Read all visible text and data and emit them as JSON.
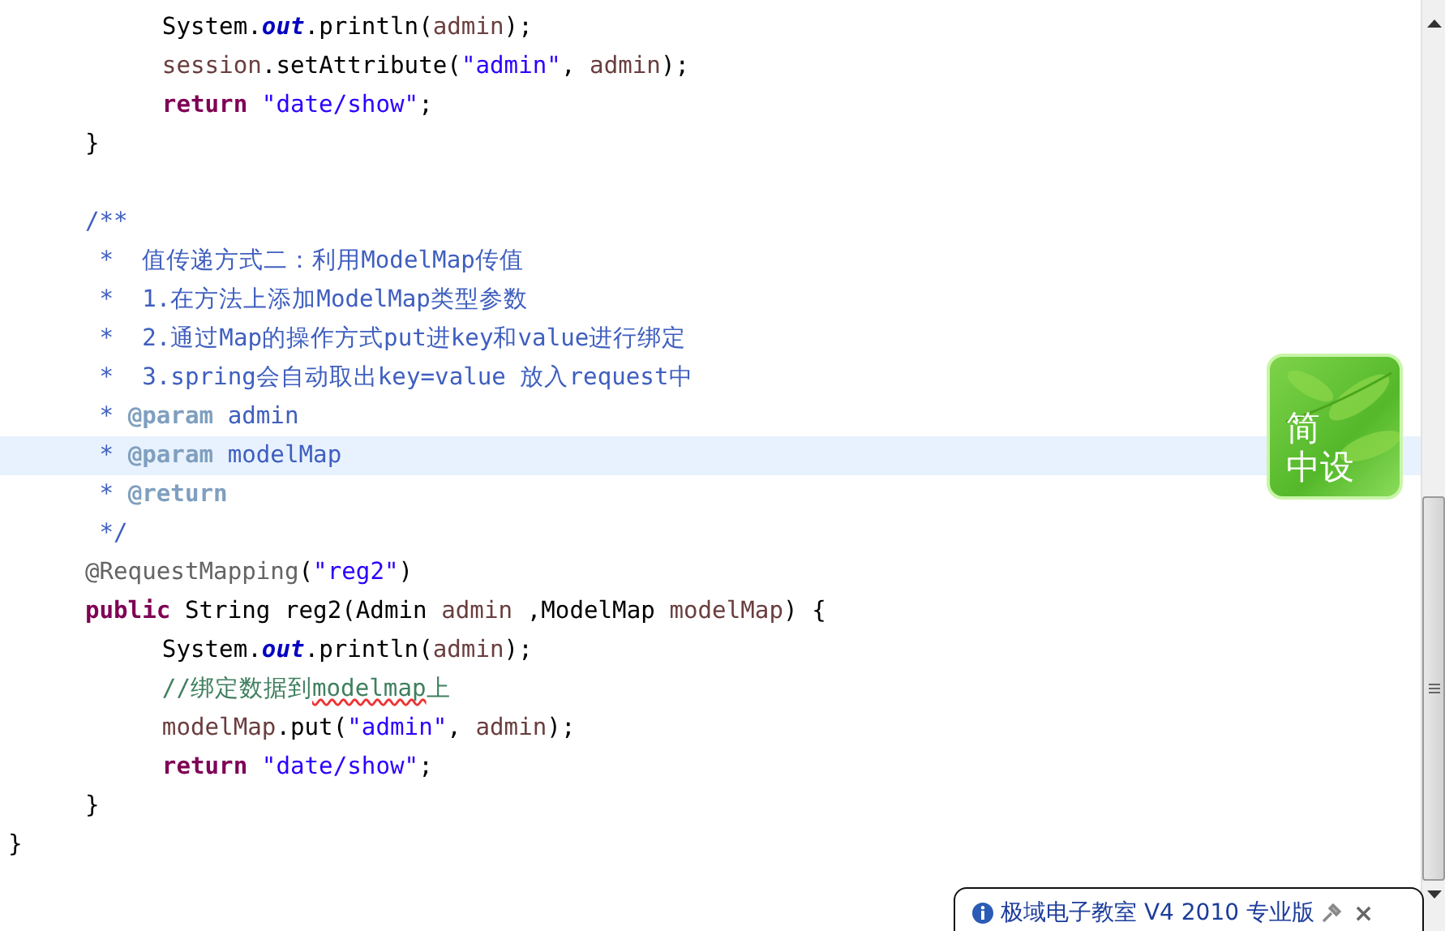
{
  "editor": {
    "lines": [
      {
        "current": false,
        "tokens": [
          {
            "kind": "plain",
            "text": "\t\tSystem."
          },
          {
            "kind": "field",
            "text": "out"
          },
          {
            "kind": "plain",
            "text": ".println("
          },
          {
            "kind": "local",
            "text": "admin"
          },
          {
            "kind": "plain",
            "text": ");"
          }
        ]
      },
      {
        "current": false,
        "tokens": [
          {
            "kind": "local",
            "text": "\t\tsession"
          },
          {
            "kind": "plain",
            "text": ".setAttribute("
          },
          {
            "kind": "string",
            "text": "\"admin\""
          },
          {
            "kind": "plain",
            "text": ", "
          },
          {
            "kind": "local",
            "text": "admin"
          },
          {
            "kind": "plain",
            "text": ");"
          }
        ]
      },
      {
        "current": false,
        "tokens": [
          {
            "kind": "keyword",
            "text": "\t\treturn"
          },
          {
            "kind": "string",
            "text": " \"date/show\""
          },
          {
            "kind": "plain",
            "text": ";"
          }
        ]
      },
      {
        "current": false,
        "tokens": [
          {
            "kind": "plain",
            "text": "\t}"
          }
        ]
      },
      {
        "current": false
      },
      {
        "current": false,
        "tokens": [
          {
            "kind": "javadoc",
            "text": "\t/**"
          }
        ]
      },
      {
        "current": false,
        "tokens": [
          {
            "kind": "javadoc",
            "text": "\t *  值传递方式二：利用ModelMap传值"
          }
        ]
      },
      {
        "current": false,
        "tokens": [
          {
            "kind": "javadoc",
            "text": "\t *  1.在方法上添加ModelMap类型参数"
          }
        ]
      },
      {
        "current": false,
        "tokens": [
          {
            "kind": "javadoc",
            "text": "\t *  2.通过Map的操作方式put进key和value进行绑定"
          }
        ]
      },
      {
        "current": false,
        "tokens": [
          {
            "kind": "javadoc",
            "text": "\t *  3.spring会自动取出key=value 放入request中"
          }
        ]
      },
      {
        "current": false,
        "tokens": [
          {
            "kind": "javadoc",
            "text": "\t * "
          },
          {
            "kind": "tag",
            "text": "@param"
          },
          {
            "kind": "javadoc",
            "text": " admin"
          }
        ]
      },
      {
        "current": true,
        "tokens": [
          {
            "kind": "javadoc",
            "text": "\t * "
          },
          {
            "kind": "tag",
            "text": "@param"
          },
          {
            "kind": "javadoc",
            "text": " modelMap"
          }
        ]
      },
      {
        "current": false,
        "tokens": [
          {
            "kind": "javadoc",
            "text": "\t * "
          },
          {
            "kind": "tag",
            "text": "@return"
          }
        ]
      },
      {
        "current": false,
        "tokens": [
          {
            "kind": "javadoc",
            "text": "\t */"
          }
        ]
      },
      {
        "current": false,
        "tokens": [
          {
            "kind": "annotation",
            "text": "\t@RequestMapping"
          },
          {
            "kind": "plain",
            "text": "("
          },
          {
            "kind": "string",
            "text": "\"reg2\""
          },
          {
            "kind": "plain",
            "text": ")"
          }
        ]
      },
      {
        "current": false,
        "tokens": [
          {
            "kind": "keyword",
            "text": "\tpublic"
          },
          {
            "kind": "plain",
            "text": " String reg2(Admin "
          },
          {
            "kind": "local",
            "text": "admin"
          },
          {
            "kind": "plain",
            "text": " ,ModelMap "
          },
          {
            "kind": "local",
            "text": "modelMap"
          },
          {
            "kind": "plain",
            "text": ") {"
          }
        ]
      },
      {
        "current": false,
        "tokens": [
          {
            "kind": "plain",
            "text": "\t\tSystem."
          },
          {
            "kind": "field",
            "text": "out"
          },
          {
            "kind": "plain",
            "text": ".println("
          },
          {
            "kind": "local",
            "text": "admin"
          },
          {
            "kind": "plain",
            "text": ");"
          }
        ]
      },
      {
        "current": false,
        "tokens": [
          {
            "kind": "comment",
            "text": "\t\t//绑定数据到"
          },
          {
            "kind": "comment",
            "text": "modelmap",
            "misspelled": true
          },
          {
            "kind": "comment",
            "text": "上"
          }
        ]
      },
      {
        "current": false,
        "tokens": [
          {
            "kind": "local",
            "text": "\t\tmodelMap"
          },
          {
            "kind": "plain",
            "text": ".put("
          },
          {
            "kind": "string",
            "text": "\"admin\""
          },
          {
            "kind": "plain",
            "text": ", "
          },
          {
            "kind": "local",
            "text": "admin"
          },
          {
            "kind": "plain",
            "text": ");"
          }
        ]
      },
      {
        "current": false,
        "tokens": [
          {
            "kind": "keyword",
            "text": "\t\treturn"
          },
          {
            "kind": "string",
            "text": " \"date/show\""
          },
          {
            "kind": "plain",
            "text": ";"
          }
        ]
      },
      {
        "current": false,
        "tokens": [
          {
            "kind": "plain",
            "text": "\t}"
          }
        ]
      },
      {
        "current": false,
        "tokens": [
          {
            "kind": "plain",
            "text": "}"
          }
        ]
      }
    ]
  },
  "widget": {
    "lines": [
      "简",
      "中设"
    ]
  },
  "notification": {
    "title": "极域电子教室 V4 2010 专业版",
    "close": "×"
  }
}
